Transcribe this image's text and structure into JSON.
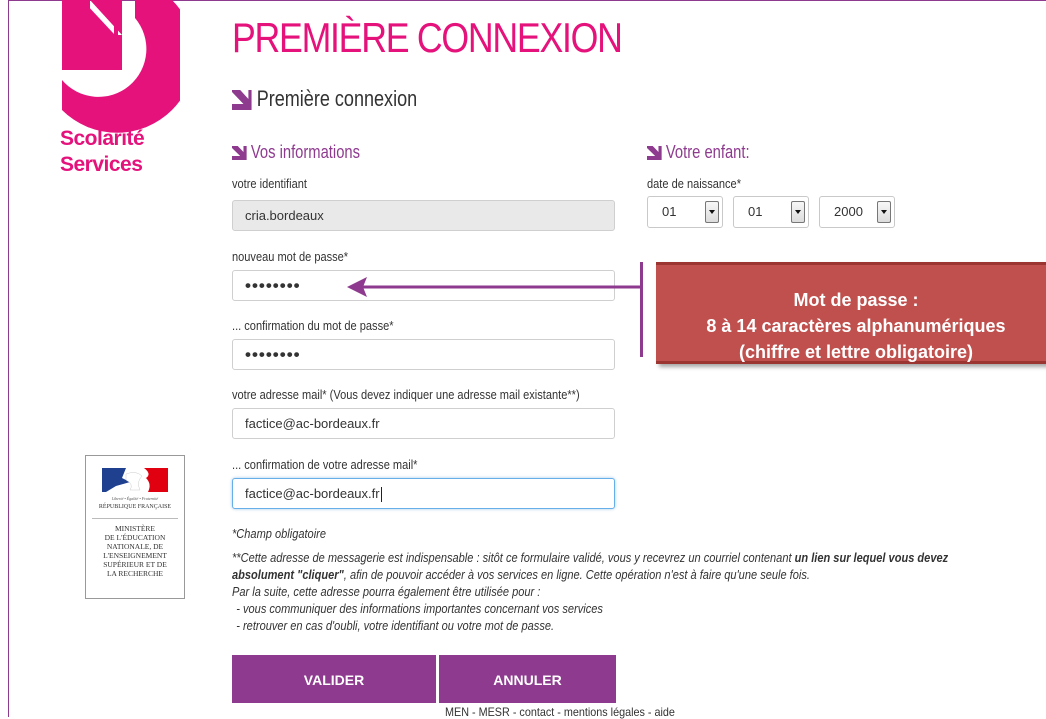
{
  "colors": {
    "accent": "#8e3a8f",
    "brand_pink": "#e5127c",
    "callout_red": "#c0504d"
  },
  "logo": {
    "line1": "Scolarité",
    "line2": "Services",
    "icon": "scolarite-services-logo-icon"
  },
  "page_title": "PREMIÈRE CONNEXION",
  "sub_title": "Première connexion",
  "section_you": "Vos informations",
  "section_child": "Votre enfant:",
  "form": {
    "identifiant_label": "votre identifiant",
    "identifiant_value": "cria.bordeaux",
    "password_label": "nouveau mot de passe*",
    "password_value": "••••••••",
    "password_confirm_label": "... confirmation du mot de passe*",
    "password_confirm_value": "••••••••",
    "email_label": "votre adresse mail* (Vous devez indiquer une adresse mail existante**)",
    "email_value": "factice@ac-bordeaux.fr",
    "email_confirm_label": "... confirmation de votre adresse mail*",
    "email_confirm_value": "factice@ac-bordeaux.fr"
  },
  "child": {
    "birthdate_label": "date de naissance*",
    "day": "01",
    "month": "01",
    "year": "2000"
  },
  "callout": {
    "line1": "Mot de passe :",
    "line2": "8 à 14 caractères alphanumériques",
    "line3": "(chiffre et lettre obligatoire)"
  },
  "ministry": {
    "motto": "Liberté • Égalité • Fraternité",
    "republic": "RÉPUBLIQUE FRANÇAISE",
    "l1": "MINISTÈRE",
    "l2": "DE L'ÉDUCATION",
    "l3": "NATIONALE, DE",
    "l4": "L'ENSEIGNEMENT",
    "l5": "SUPÉRIEUR ET DE",
    "l6": "LA RECHERCHE"
  },
  "notes": {
    "required": "*Champ obligatoire",
    "email_note_a": "**Cette adresse de messagerie est indispensable : sitôt ce formulaire validé, vous y recevrez un courriel contenant ",
    "email_note_b": "un lien sur lequel vous devez",
    "email_note_c": "absolument \"cliquer\"",
    "email_note_d": ", afin de pouvoir accéder à vos services en ligne. Cette opération n'est à faire qu'une seule fois.",
    "email_note_e": "Par la suite, cette adresse pourra également être utilisée pour :",
    "bullet1": "- vous communiquer des informations importantes concernant vos services",
    "bullet2": "- retrouver en cas d'oubli, votre identifiant ou votre mot de passe."
  },
  "buttons": {
    "validate": "VALIDER",
    "cancel": "ANNULER"
  },
  "footer": {
    "men": "MEN",
    "mesr": "MESR",
    "contact": "contact",
    "legal": "mentions légales",
    "help": "aide",
    "separator": " - "
  }
}
